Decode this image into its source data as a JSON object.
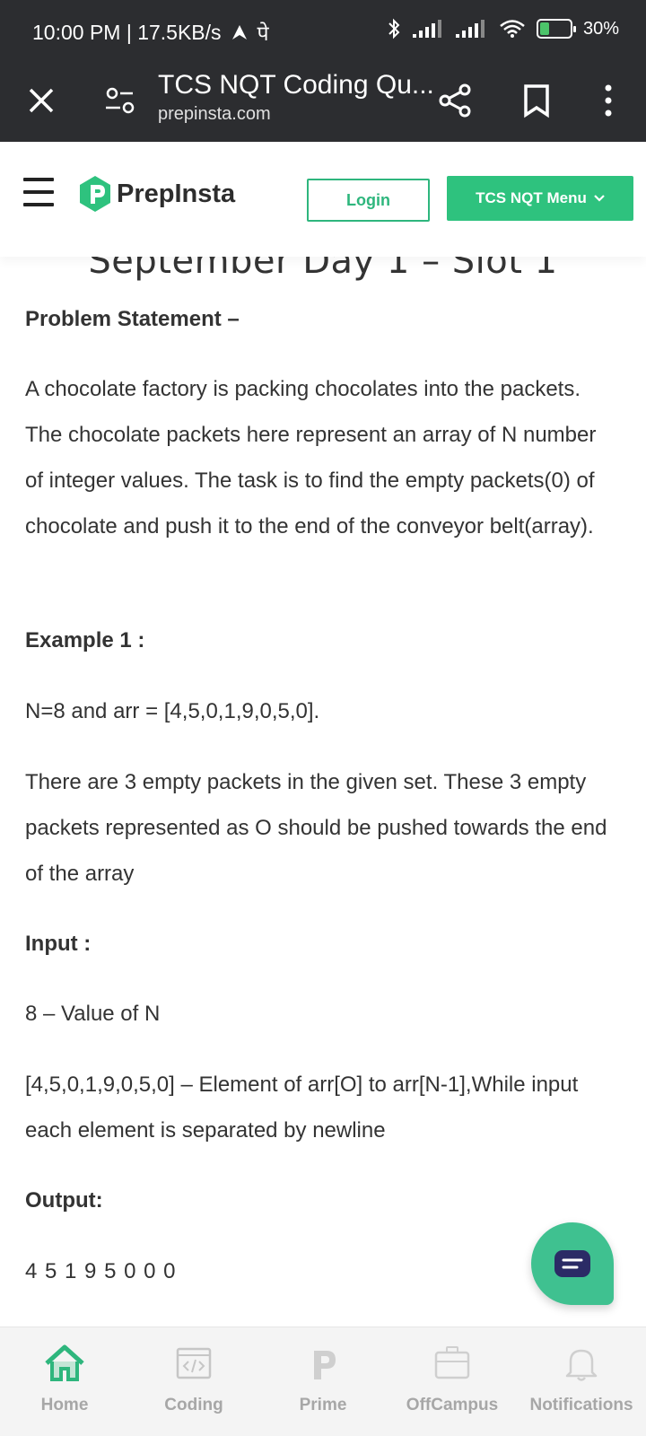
{
  "status_bar": {
    "time_speed": "10:00 PM | 17.5KB/s",
    "extra_glyph": "पे",
    "battery_percent": "30%",
    "battery_level": 0.3
  },
  "tab_bar": {
    "title": "TCS NQT Coding Qu...",
    "url": "prepinsta.com"
  },
  "header": {
    "logo_text": "PrepInsta",
    "login_label": "Login",
    "menu_label": "TCS NQT Menu"
  },
  "article": {
    "title": "September Day 1 – Slot 1",
    "problem_heading": "Problem Statement –",
    "problem_text": "A chocolate factory is packing chocolates into the packets. The chocolate packets here represent an array of N number of integer values. The task is to find the empty packets(0) of chocolate and push it to the end of the conveyor belt(array).",
    "example_heading": "Example 1 :",
    "example_line": "N=8 and arr = [4,5,0,1,9,0,5,0].",
    "example_explain": "There are 3 empty packets in the given set. These 3 empty packets represented as O should be pushed towards the end of the array",
    "input_heading": "Input :",
    "input_line1": "8  – Value of N",
    "input_line2": "[4,5,0,1,9,0,5,0] – Element of arr[O] to arr[N-1],While input each element is separated by newline",
    "output_heading": "Output:",
    "output_line": "4 5 1 9 5 0 0 0"
  },
  "bottom_nav": {
    "items": [
      {
        "label": "Home",
        "icon": "home-icon",
        "active": true
      },
      {
        "label": "Coding",
        "icon": "code-icon"
      },
      {
        "label": "Prime",
        "icon": "prime-icon"
      },
      {
        "label": "OffCampus",
        "icon": "job-icon"
      },
      {
        "label": "Notifications",
        "icon": "bell-icon"
      }
    ]
  },
  "colors": {
    "brand_green": "#2ec27e",
    "status_bar_bg": "#2c2d30",
    "chat_fab": "#3fc190"
  }
}
